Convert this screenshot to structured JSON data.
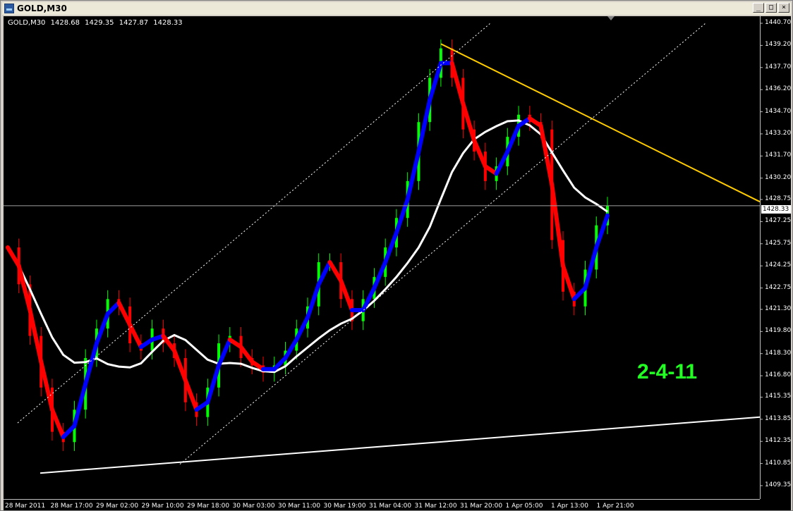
{
  "window": {
    "title": "GOLD,M30",
    "buttons": {
      "minimize": "_",
      "restore": "□",
      "close": "×"
    }
  },
  "chart": {
    "ohlc_label": {
      "symbol": "GOLD,M30",
      "open": "1428.68",
      "high": "1429.35",
      "low": "1427.87",
      "close": "1428.33"
    },
    "current_price_label": "1428.33",
    "annotation": "2-4-11",
    "colors": {
      "background": "#000000",
      "bull": "#00ff00",
      "bear": "#ff0000",
      "hma_up": "#0000ff",
      "hma_down": "#ff0000",
      "sma_slow": "#ffffff",
      "trend_upper": "#ffcc00",
      "trend_lower": "#ffffff"
    }
  },
  "chart_data": {
    "type": "line",
    "ylim": [
      1409.35,
      1440.7
    ],
    "y_ticks": [
      "1440.70",
      "1439.20",
      "1437.70",
      "1436.20",
      "1434.70",
      "1433.20",
      "1431.70",
      "1430.20",
      "1428.75",
      "1427.25",
      "1425.75",
      "1424.25",
      "1422.75",
      "1421.30",
      "1419.80",
      "1418.30",
      "1416.80",
      "1415.35",
      "1413.85",
      "1412.35",
      "1410.85",
      "1409.35"
    ],
    "x_ticks": [
      "28 Mar 2011",
      "28 Mar 17:00",
      "29 Mar 02:00",
      "29 Mar 10:00",
      "29 Mar 18:00",
      "30 Mar 03:00",
      "30 Mar 11:00",
      "30 Mar 19:00",
      "31 Mar 04:00",
      "31 Mar 12:00",
      "31 Mar 20:00",
      "1 Apr 05:00",
      "1 Apr 13:00",
      "1 Apr 21:00"
    ],
    "series": [
      {
        "name": "price",
        "values": [
          1425.5,
          1423.0,
          1419.5,
          1416.0,
          1413.0,
          1412.3,
          1414.5,
          1418.0,
          1420.0,
          1422.0,
          1421.5,
          1419.0,
          1418.5,
          1420.0,
          1419.0,
          1418.0,
          1415.0,
          1414.0,
          1416.0,
          1419.0,
          1419.5,
          1418.0,
          1417.5,
          1417.0,
          1417.5,
          1418.5,
          1420.0,
          1421.5,
          1424.5,
          1424.5,
          1422.0,
          1420.5,
          1422.0,
          1423.5,
          1425.5,
          1427.5,
          1430.0,
          1434.0,
          1437.0,
          1439.0,
          1437.0,
          1433.5,
          1432.0,
          1430.0,
          1431.0,
          1433.0,
          1434.5,
          1434.0,
          1433.5,
          1426.0,
          1422.5,
          1421.5,
          1424.0,
          1427.0,
          1428.33
        ]
      }
    ]
  }
}
